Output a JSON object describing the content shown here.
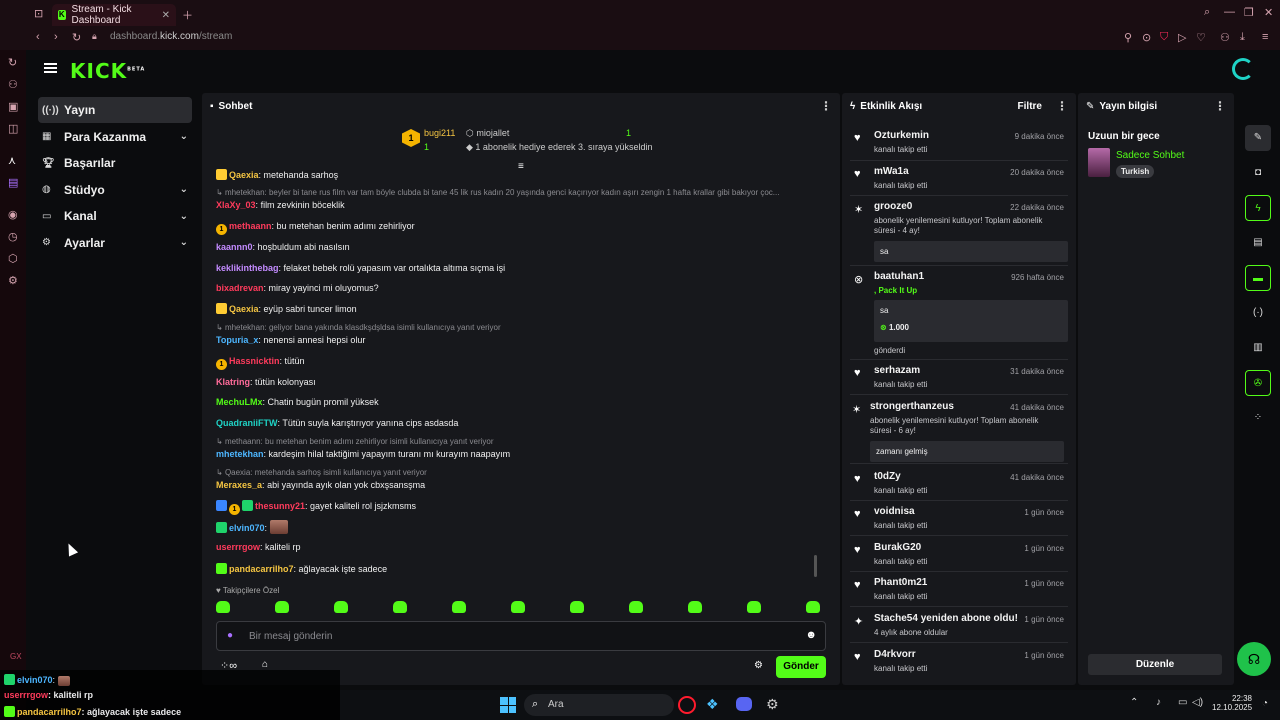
{
  "browser": {
    "tab_title": "Stream - Kick Dashboard",
    "tab_favicon": "K",
    "url_prefix": "dashboard.",
    "url_host": "kick.com",
    "url_path": "/stream"
  },
  "brand": {
    "logo": "KICK",
    "beta": "BETA",
    "accent": "#53fc18"
  },
  "sidebar": {
    "items": [
      {
        "label": "Yayın",
        "icon": "broadcast-icon"
      },
      {
        "label": "Para Kazanma",
        "icon": "money-icon"
      },
      {
        "label": "Başarılar",
        "icon": "trophy-icon"
      },
      {
        "label": "Stüdyo",
        "icon": "studio-icon"
      },
      {
        "label": "Kanal",
        "icon": "channel-icon"
      },
      {
        "label": "Ayarlar",
        "icon": "gear-icon"
      }
    ]
  },
  "chat": {
    "title": "Sohbet",
    "pinned": {
      "user1": "bugi211",
      "count1": "1",
      "user2": "miojallet",
      "count2": "1",
      "text": "1 abonelik hediye ederek 3. sıraya yükseldin"
    },
    "lines": [
      {
        "user": "Qaexia",
        "color": "#f5c542",
        "text": "metehanda sarhoş"
      },
      {
        "reply": "mhetekhan: beyler bi tane rus film var tam böyle clubda bi tane 45 lik rus kadın 20 yaşında genci kaçırıyor kadın aşırı zengin 1 hafta krallar gibi bakıyor çoc..."
      },
      {
        "user": "XlaXy_03",
        "color": "#ff3b5c",
        "text": "film zevkinin böceklik"
      },
      {
        "user": "methaann",
        "color": "#ff3b5c",
        "text": "bu metehan benim adımı zehirliyor"
      },
      {
        "user": "kaannn0",
        "color": "#c38bff",
        "text": "hoşbuldum abi nasılsın"
      },
      {
        "user": "keklikinthebag",
        "color": "#c38bff",
        "text": "felaket bebek rolü yapasım var ortalıkta altıma sıçma işi"
      },
      {
        "user": "bixadrevan",
        "color": "#ff3b5c",
        "text": "miray yayinci mi oluyomus?"
      },
      {
        "user": "Qaexia",
        "color": "#f5c542",
        "text": "eyüp sabri tuncer limon"
      },
      {
        "reply": "mhetekhan: geliyor bana yakında klasdkşdşldsa isimli kullanıcıya yanıt veriyor"
      },
      {
        "user": "Topuria_x",
        "color": "#4db6ff",
        "text": "nenensi annesi hepsi olur"
      },
      {
        "user": "Hassnicktin",
        "color": "#ff3b5c",
        "text": "tütün"
      },
      {
        "user": "Klatring",
        "color": "#ff6b9a",
        "text": "tütün kolonyası"
      },
      {
        "user": "MechuLMx",
        "color": "#53fc18",
        "text": "Chatin bugün promil yüksek"
      },
      {
        "user": "QuadraniiFTW",
        "color": "#1fd3c6",
        "text": "Tütün suyla karıştırıyor yanına cips asdasda"
      },
      {
        "reply": "methaann: bu metehan benim adımı zehirliyor isimli kullanıcıya yanıt veriyor"
      },
      {
        "user": "mhetekhan",
        "color": "#4db6ff",
        "text": "kardeşim hilal taktiğimi yapayım turanı mı kurayım naapayım"
      },
      {
        "reply": "Qaexia: metehanda sarhoş isimli kullanıcıya yanıt veriyor"
      },
      {
        "user": "Meraxes_a",
        "color": "#f5c542",
        "text": "abi yayında ayık olan yok cbxşsansşma"
      },
      {
        "user": "thesunny21",
        "color": "#ff3b5c",
        "text": "gayet kaliteli rol jsjzkmsms"
      },
      {
        "user": "elvin070",
        "color": "#4db6ff",
        "text": ""
      },
      {
        "user": "userrrgow",
        "color": "#ff3b5c",
        "text": "kaliteli rp"
      },
      {
        "user": "pandacarrilho7",
        "color": "#f5c542",
        "text": "ağlayacak işte sadece"
      }
    ],
    "followers_only": "Takipçilere Özel",
    "input_placeholder": "Bir mesaj gönderin",
    "send_label": "Gönder"
  },
  "activity": {
    "title": "Etkinlik Akışı",
    "filter_label": "Filtre",
    "items": [
      {
        "user": "Ozturkemin",
        "time": "9 dakika önce",
        "sub": "kanalı takip etti"
      },
      {
        "user": "mWa1a",
        "time": "20 dakika önce",
        "sub": "kanalı takip etti"
      },
      {
        "user": "grooze0",
        "time": "22 dakika önce",
        "sub": "abonelik yenilemesini kutluyor! Toplam abonelik süresi - 4 ay!",
        "box": "sa"
      },
      {
        "user": "baatuhan1",
        "time": "926 hafta önce",
        "sub": ", Pack It Up",
        "box": "sa",
        "amount": "1.000",
        "after": "gönderdi"
      },
      {
        "user": "serhazam",
        "time": "31 dakika önce",
        "sub": "kanalı takip etti"
      },
      {
        "user": "strongerthanzeus",
        "time": "41 dakika önce",
        "sub": "abonelik yenilemesini kutluyor! Toplam abonelik süresi - 6 ay!",
        "box": "zamanı gelmiş"
      },
      {
        "user": "t0dZy",
        "time": "41 dakika önce",
        "sub": "kanalı takip etti"
      },
      {
        "user": "voidnisa",
        "time": "1 gün önce",
        "sub": "kanalı takip etti"
      },
      {
        "user": "BurakG20",
        "time": "1 gün önce",
        "sub": "kanalı takip etti"
      },
      {
        "user": "Phant0m21",
        "time": "1 gün önce",
        "sub": "kanalı takip etti"
      },
      {
        "user": "Stache54 yeniden abone oldu!",
        "time": "1 gün önce",
        "sub": "4 aylık abone oldular"
      },
      {
        "user": "D4rkvorr",
        "time": "1 gün önce",
        "sub": "kanalı takip etti"
      }
    ]
  },
  "stream_info": {
    "title": "Yayın bilgisi",
    "stream_title": "Uzuun bir gece",
    "category": "Sadece Sohbet",
    "language": "Turkish",
    "edit_label": "Düzenle"
  },
  "overlay": [
    {
      "user": "elvin070",
      "text": ":"
    },
    {
      "user": "userrrgow",
      "text": ": kaliteli rp"
    },
    {
      "user": "pandacarrilho7",
      "text": ": ağlayacak işte sadece"
    }
  ],
  "taskbar": {
    "search_placeholder": "Ara",
    "time": "22:38",
    "date": "12.10.2025"
  },
  "gx_label": "GX"
}
